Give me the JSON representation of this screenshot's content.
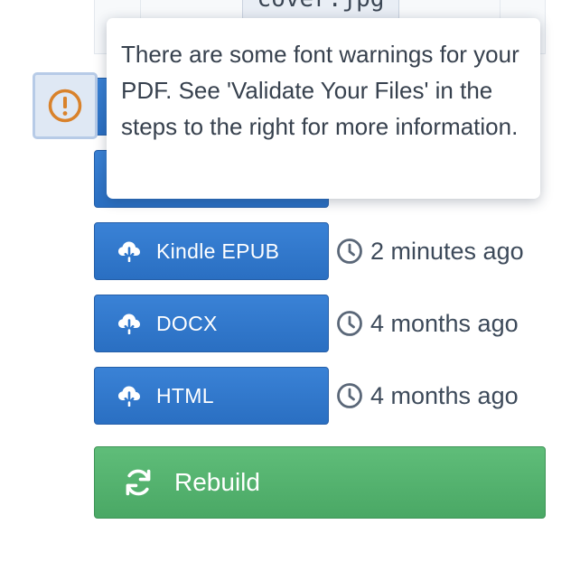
{
  "top_table": {
    "code_chip_text": "cover.jpg"
  },
  "warning": {
    "icon": "exclamation-circle-icon",
    "color": "#d9822b"
  },
  "tooltip": {
    "text": "There are some font warnings for your PDF. See 'Validate Your Files' in the steps to the right for more information."
  },
  "downloads": [
    {
      "label": "",
      "timestamp": ""
    },
    {
      "label": "",
      "timestamp": ""
    },
    {
      "label": "Kindle EPUB",
      "timestamp": "2 minutes ago"
    },
    {
      "label": "DOCX",
      "timestamp": "4 months ago"
    },
    {
      "label": "HTML",
      "timestamp": "4 months ago"
    }
  ],
  "icons": {
    "download": "cloud-download-icon",
    "clock": "clock-icon",
    "rebuild": "sync-icon"
  },
  "rebuild": {
    "label": "Rebuild"
  },
  "colors": {
    "primary_button": "#2f77cc",
    "success_button": "#52b06d",
    "warning_icon": "#d9822b",
    "text": "#3d4a5a"
  }
}
